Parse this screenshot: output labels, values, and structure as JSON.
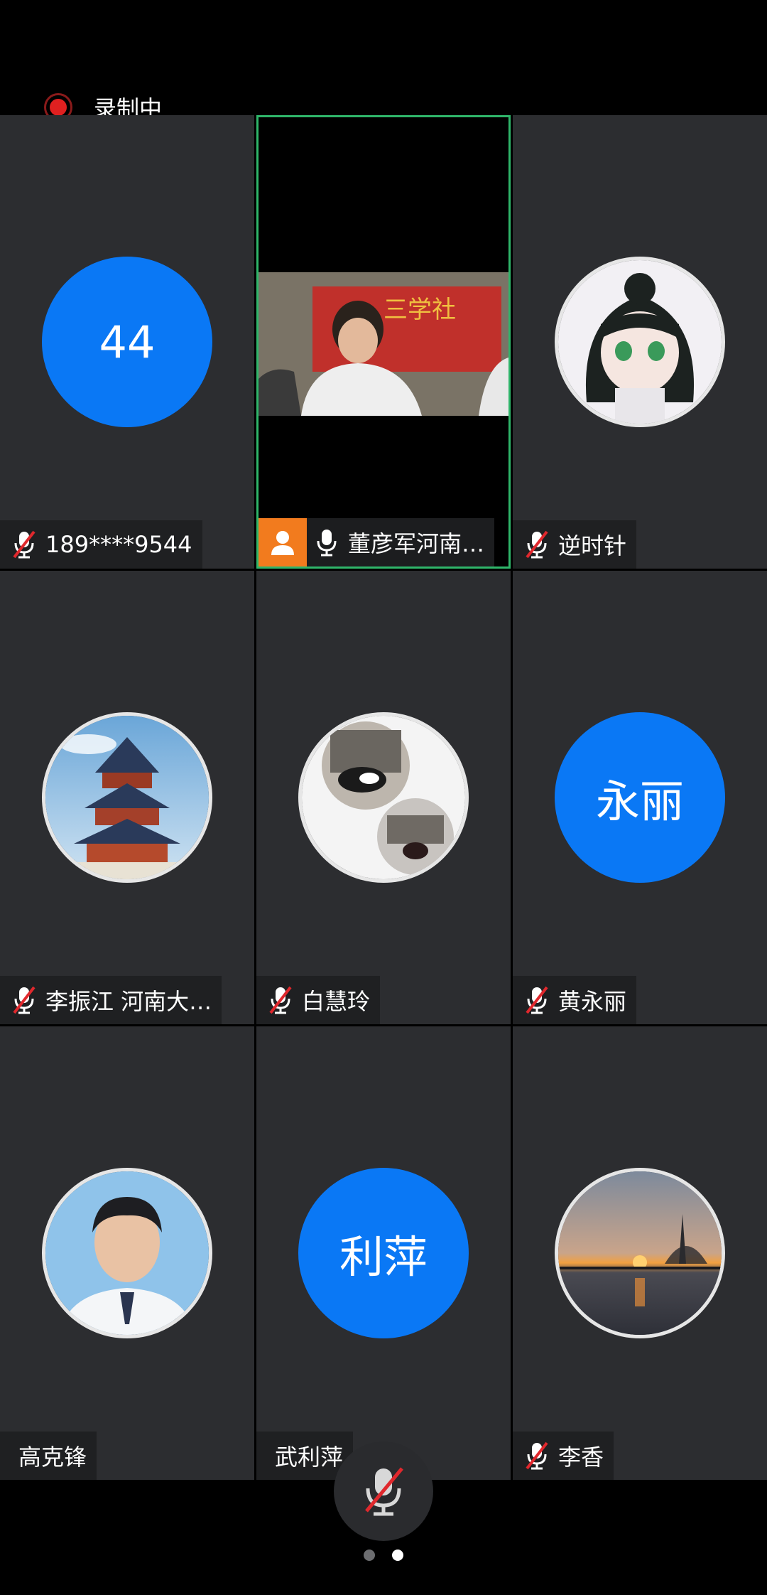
{
  "recording": {
    "label": "录制中"
  },
  "tiles": [
    {
      "name": "189****9544",
      "avatar_text": "44"
    },
    {
      "name": "董彦军河南…"
    },
    {
      "name": "逆时针"
    },
    {
      "name": "李振江 河南大…"
    },
    {
      "name": "白慧玲"
    },
    {
      "name": "黄永丽",
      "avatar_text": "永丽"
    },
    {
      "name": "高克锋"
    },
    {
      "name": "武利萍",
      "avatar_text": "利萍"
    },
    {
      "name": "李香"
    }
  ],
  "video_banner_text": "三学社",
  "colors": {
    "avatar_blue": "#0a78f5",
    "active_border": "#2fb56a",
    "host_badge": "#f27b1e",
    "mute_red": "#e0282d"
  },
  "pager": {
    "current": 2,
    "total": 2
  }
}
